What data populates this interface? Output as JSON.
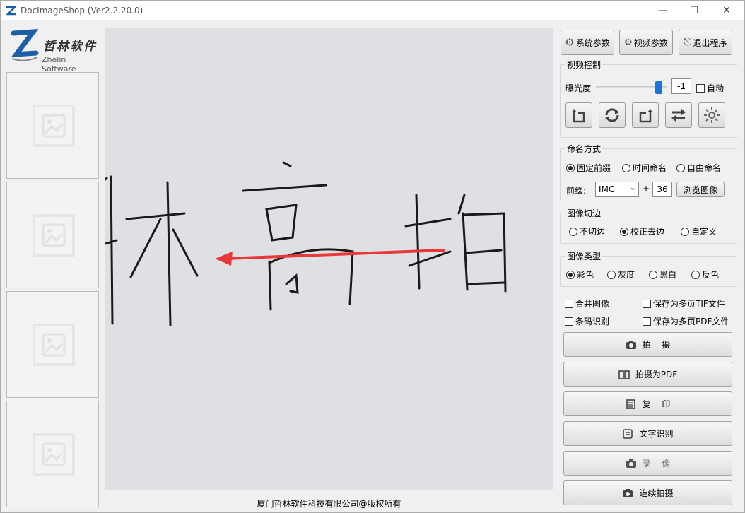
{
  "window": {
    "title": "DocImageShop (Ver2.2.20.0)",
    "minimize": "—",
    "maximize": "☐",
    "close": "✕"
  },
  "logo": {
    "cn": "哲林软件",
    "en": "Zhelin Software",
    "mark": "Z"
  },
  "status": {
    "copyright": "厦门哲林软件科技有限公司@版权所有"
  },
  "viewer": {
    "handwriting": [
      "林",
      "高",
      "拍"
    ]
  },
  "toolbar": {
    "system_params": "系统参数",
    "video_params": "视频参数",
    "exit": "退出程序"
  },
  "video_control": {
    "legend": "视频控制",
    "exposure_label": "曝光度",
    "exposure_value": "-1",
    "exposure_level": 0.94,
    "auto_label": "自动",
    "icon_buttons": [
      "rotate-left-icon",
      "rotate-180-icon",
      "rotate-right-icon",
      "swap-icon",
      "brightness-icon"
    ]
  },
  "naming": {
    "legend": "命名方式",
    "options": [
      "固定前缀",
      "时间命名",
      "自由命名"
    ],
    "selected": 0,
    "prefix_label": "前缀:",
    "prefix_value": "IMG",
    "plus": "+",
    "number": "36",
    "browse": "浏览图像"
  },
  "crop": {
    "legend": "图像切边",
    "options": [
      "不切边",
      "校正去边",
      "自定义"
    ],
    "selected": 1
  },
  "image_type": {
    "legend": "图像类型",
    "options": [
      "彩色",
      "灰度",
      "黑白",
      "反色"
    ],
    "selected": 0
  },
  "options": {
    "merge": "合并图像",
    "save_tif": "保存为多页TIF文件",
    "barcode": "条码识别",
    "save_pdf": "保存为多页PDF文件"
  },
  "actions": {
    "capture": "拍　 摄",
    "capture_pdf": "拍摄为PDF",
    "copy": "复　 印",
    "ocr": "文字识别",
    "record": "录　 像",
    "continuous": "连续拍摄"
  },
  "colors": {
    "arrow": "#e8383a",
    "slider_thumb": "#1a73d9"
  }
}
